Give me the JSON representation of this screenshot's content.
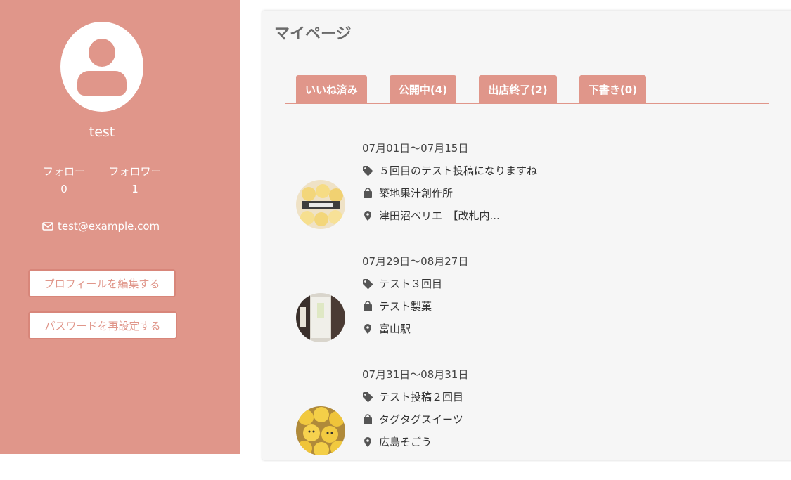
{
  "profile": {
    "username": "test",
    "follow_label": "フォロー",
    "follow_count": "0",
    "follower_label": "フォロワー",
    "follower_count": "1",
    "email": "test@example.com",
    "edit_profile_button": "プロフィールを編集する",
    "reset_password_button": "パスワードを再設定する"
  },
  "page": {
    "title": "マイページ"
  },
  "tabs": [
    {
      "label": "いいね済み"
    },
    {
      "label": "公開中(4)"
    },
    {
      "label": "出店終了(2)"
    },
    {
      "label": "下書き(0)"
    }
  ],
  "posts": [
    {
      "date": "07月01日〜07月15日",
      "title": "５回目のテスト投稿になりますね",
      "shop": "築地果汁創作所",
      "location": "津田沼ペリエ　【改札内..."
    },
    {
      "date": "07月29日〜08月27日",
      "title": "テスト３回目",
      "shop": "テスト製菓",
      "location": "富山駅"
    },
    {
      "date": "07月31日〜08月31日",
      "title": "テスト投稿２回目",
      "shop": "タグタグスイーツ",
      "location": "広島そごう"
    }
  ],
  "colors": {
    "accent": "#e0968a",
    "panel_bg": "#f6f6f6"
  }
}
